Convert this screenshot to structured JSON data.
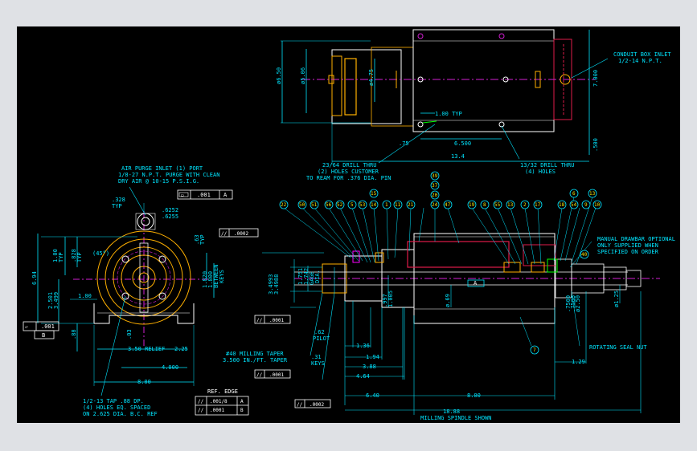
{
  "drawing": {
    "background": "#000000",
    "colors": {
      "dimension": "#00e5ff",
      "annotation": "#f5e60a",
      "outline": "#ffffff",
      "hidden": "#e01b4a",
      "center": "#d21fd2",
      "accent": "#ffb000"
    },
    "top_view": {
      "dims": [
        "ø6.50",
        "ø5.06",
        "ø4.75",
        "7.000",
        ".500",
        "1.00 TYP",
        "6.500",
        "13.4",
        ".75"
      ],
      "notes": [
        "CONDUIT BOX INLET",
        "1/2-14 N.P.T.",
        "13/32 DRILL THRU",
        "(4) HOLES",
        "23/64 DRILL THRU",
        "(2) HOLES CUSTOMER",
        "TO REAM FOR .376 DIA. PIN"
      ]
    },
    "end_view": {
      "notes": [
        "AIR PURGE INLET (1) PORT",
        "1/8-27 N.P.T. PURGE WITH CLEAN",
        "DRY AIR @ 10-15 P.S.I.G.",
        "1/2-13 TAP .88 DP.",
        "(4) HOLES EQ. SPACED",
        "ON 2.625 DIA. B.C. REF"
      ],
      "dims": [
        ".328",
        "TYP",
        ".6252",
        ".6255",
        "1.00",
        "TYP",
        ".828",
        "TYP",
        "(45°)",
        ".63",
        "TYP",
        "6.94",
        "1.820",
        "1.800",
        "BETWEEN",
        "KEYS",
        "2.501",
        "3.499",
        "1.00",
        ".88",
        ".03",
        "3.50 RELIEF",
        "2.25",
        "4.000",
        "8.00"
      ],
      "tolerance_flatness": ".001",
      "tolerance_flatness_ref": "A",
      "datum_b": "B",
      "datum_tol": ".001"
    },
    "ref_edge": {
      "title": "REF. EDGE",
      "rows": [
        {
          "sym": "//",
          "val": ".001/8",
          "ref": "A"
        },
        {
          "sym": "//",
          "val": ".0001",
          "ref": "B"
        }
      ]
    },
    "side_view": {
      "balloons": [
        "22",
        "50",
        "51",
        "56",
        "52",
        "5",
        "53",
        "14",
        "15",
        "1",
        "11",
        "21",
        "39",
        "37",
        "20",
        "24",
        "47",
        "19",
        "8",
        "55",
        "13",
        "2",
        "17",
        "18",
        "54",
        "6",
        "13",
        "9",
        "10",
        "40",
        "7"
      ],
      "notes": [
        "MANUAL DRAWBAR OPTIONAL",
        "ONLY SUPPLIED WHEN",
        "SPECIFIED ON ORDER",
        "ROTATING SEAL NUT",
        "#40 MILLING TAPER",
        "3.500 IN./FT. TAPER",
        "MILLING SPINDLE SHOWN"
      ],
      "dims": [
        "3.4993",
        "3.4988",
        "1.751",
        "1.742",
        "GAGE",
        "DIA.",
        ".997",
        "1.005",
        ".62",
        "PILOT",
        ".31",
        "KEYS",
        "1.36",
        "1.94",
        "3.88",
        "4.64",
        "6.40",
        "8.00",
        "18.88",
        "ø.69",
        "ø2.50",
        "ø1.25",
        ".7500",
        ".7508",
        "1.29",
        "A"
      ],
      "runout_1": ".0002",
      "runout_2": ".0001",
      "runout_3": ".0001",
      "runout_4": ".0002"
    }
  }
}
